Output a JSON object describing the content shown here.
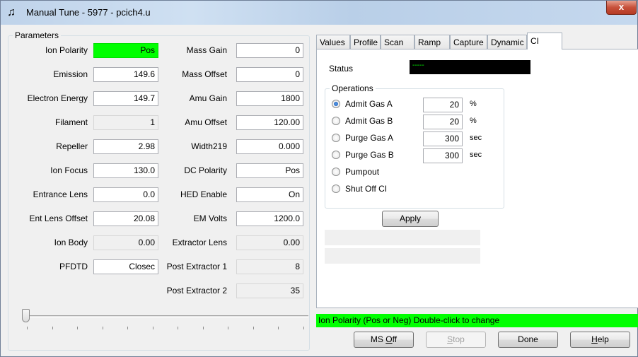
{
  "window": {
    "title": "Manual Tune - 5977 - pcich4.u",
    "app_icon": "music-note-icon",
    "close_glyph": "x"
  },
  "parameters": {
    "legend": "Parameters",
    "left": [
      {
        "label": "Ion Polarity",
        "value": "Pos",
        "style": "green"
      },
      {
        "label": "Emission",
        "value": "149.6",
        "style": "edit"
      },
      {
        "label": "Electron Energy",
        "value": "149.7",
        "style": "edit"
      },
      {
        "label": "Filament",
        "value": "1",
        "style": "readonly"
      },
      {
        "label": "Repeller",
        "value": "2.98",
        "style": "edit"
      },
      {
        "label": "Ion Focus",
        "value": "130.0",
        "style": "edit"
      },
      {
        "label": "Entrance Lens",
        "value": "0.0",
        "style": "edit"
      },
      {
        "label": "Ent Lens Offset",
        "value": "20.08",
        "style": "edit"
      },
      {
        "label": "Ion Body",
        "value": "0.00",
        "style": "readonly"
      },
      {
        "label": "PFDTD",
        "value": "Closec",
        "style": "edit"
      }
    ],
    "right": [
      {
        "label": "Mass Gain",
        "value": "0",
        "style": "edit"
      },
      {
        "label": "Mass Offset",
        "value": "0",
        "style": "edit"
      },
      {
        "label": "Amu Gain",
        "value": "1800",
        "style": "edit"
      },
      {
        "label": "Amu Offset",
        "value": "120.00",
        "style": "edit"
      },
      {
        "label": "Width219",
        "value": "0.000",
        "style": "edit"
      },
      {
        "label": "DC Polarity",
        "value": "Pos",
        "style": "edit"
      },
      {
        "label": "HED Enable",
        "value": "On",
        "style": "edit"
      },
      {
        "label": "EM Volts",
        "value": "1200.0",
        "style": "edit"
      },
      {
        "label": "Extractor Lens",
        "value": "0.00",
        "style": "readonly"
      },
      {
        "label": "Post Extractor 1",
        "value": "8",
        "style": "readonly"
      },
      {
        "label": "Post Extractor 2",
        "value": "35",
        "style": "readonly"
      }
    ]
  },
  "tabs": [
    {
      "label": "Values"
    },
    {
      "label": "Profile"
    },
    {
      "label": "Scan"
    },
    {
      "label": "Ramp"
    },
    {
      "label": "Capture"
    },
    {
      "label": "Dynamic"
    },
    {
      "label": "CI",
      "active": true
    }
  ],
  "ci": {
    "status_label": "Status",
    "status_value": "-----",
    "operations_legend": "Operations",
    "operations": [
      {
        "label": "Admit Gas A",
        "selected": true,
        "value": "20",
        "unit": "%"
      },
      {
        "label": "Admit Gas B",
        "selected": false,
        "value": "20",
        "unit": "%"
      },
      {
        "label": "Purge Gas A",
        "selected": false,
        "value": "300",
        "unit": "sec"
      },
      {
        "label": "Purge Gas B",
        "selected": false,
        "value": "300",
        "unit": "sec"
      },
      {
        "label": "Pumpout",
        "selected": false
      },
      {
        "label": "Shut Off CI",
        "selected": false
      }
    ],
    "apply_label": "Apply"
  },
  "hint": "Ion Polarity (Pos or Neg)   Double-click to change",
  "buttons": {
    "ms_off": {
      "pre": "MS ",
      "ul": "O",
      "post": "ff"
    },
    "stop": {
      "pre": "",
      "ul": "S",
      "post": "top"
    },
    "done": "Done",
    "help": {
      "pre": "",
      "ul": "H",
      "post": "elp"
    }
  }
}
